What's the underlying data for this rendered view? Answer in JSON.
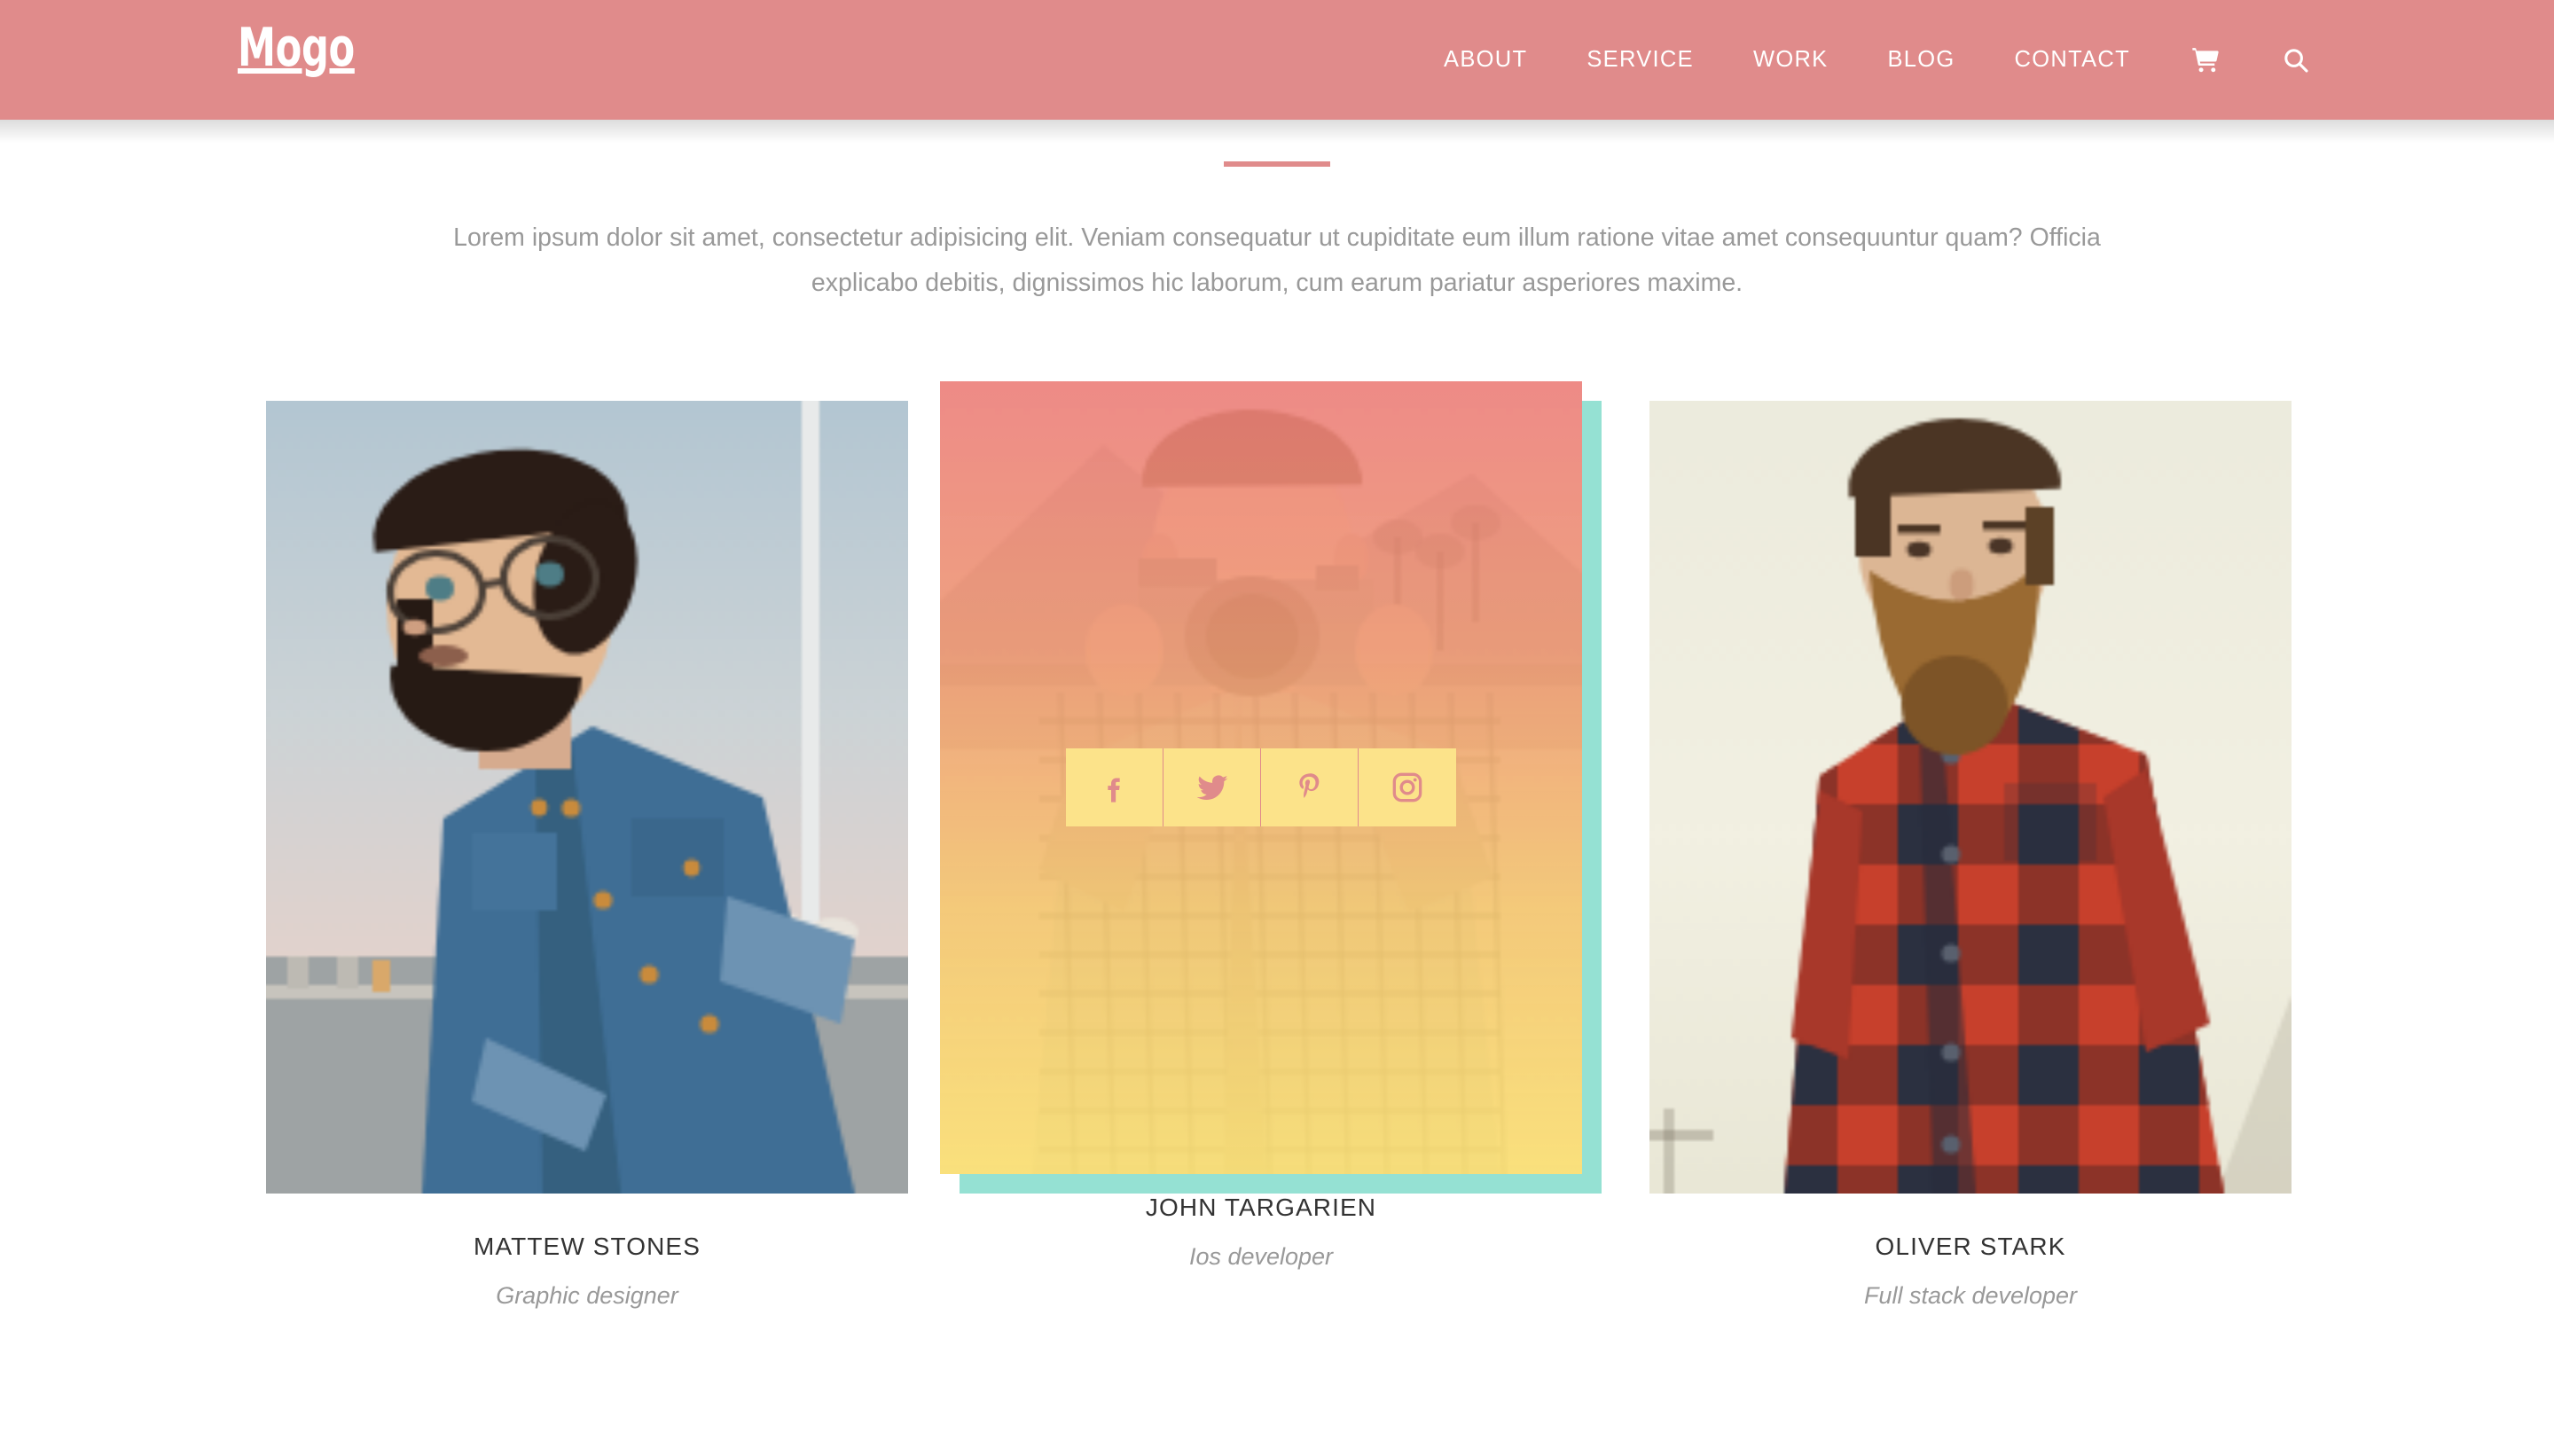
{
  "header": {
    "brand": "Mogo",
    "brand_color": "#ffffff",
    "background_color": "#e08b8b",
    "nav": [
      {
        "label": "ABOUT",
        "name": "nav-link-about"
      },
      {
        "label": "SERVICE",
        "name": "nav-link-service"
      },
      {
        "label": "WORK",
        "name": "nav-link-work"
      },
      {
        "label": "BLOG",
        "name": "nav-link-blog"
      },
      {
        "label": "CONTACT",
        "name": "nav-link-contact"
      }
    ],
    "icons": [
      {
        "icon": "shopping-cart-icon"
      },
      {
        "icon": "search-icon"
      }
    ]
  },
  "section": {
    "divider_color": "#e08b8b",
    "intro_text": "Lorem ipsum dolor sit amet, consectetur adipisicing elit. Veniam consequatur ut cupiditate eum illum ratione vitae amet consequuntur quam? Officia explicabo debitis, dignissimos hic laborum, cum earum pariatur asperiores maxime."
  },
  "team": {
    "accent_shadow_color": "#95e1d3",
    "social_tile_color": "#fce38a",
    "social_icon_color": "#e08b8b",
    "members": [
      {
        "name": "MATTEW STONES",
        "role": "Graphic designer",
        "photo_alt": "bearded man with glasses in denim shirt",
        "active": false
      },
      {
        "name": "JOHN TARGARIEN",
        "role": "Ios developer",
        "photo_alt": "young man holding a camera in the desert",
        "active": true,
        "social": [
          {
            "icon": "facebook-icon",
            "label": "Facebook"
          },
          {
            "icon": "twitter-icon",
            "label": "Twitter"
          },
          {
            "icon": "pinterest-icon",
            "label": "Pinterest"
          },
          {
            "icon": "instagram-icon",
            "label": "Instagram"
          }
        ]
      },
      {
        "name": "OLIVER STARK",
        "role": "Full stack developer",
        "photo_alt": "bearded man in red plaid flannel shirt",
        "active": false
      }
    ]
  }
}
